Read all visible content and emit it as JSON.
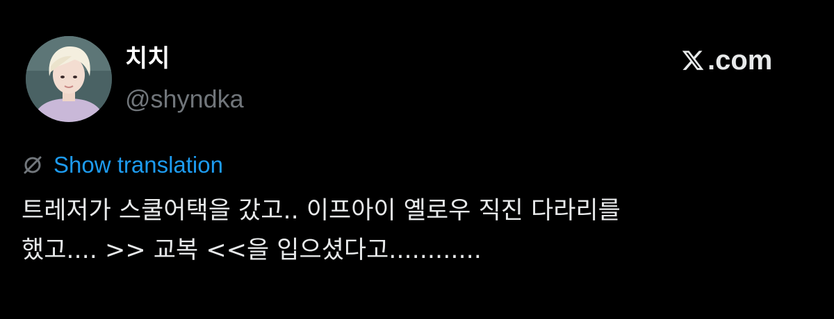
{
  "author": {
    "display_name": "치치",
    "handle": "@shyndka",
    "avatar_icon": "avatar-photo"
  },
  "brand": {
    "logo_icon": "x-logo-icon",
    "site_label": ".com"
  },
  "translation": {
    "icon": "globe-icon",
    "link_label": "Show translation",
    "color": "#1d9bf0"
  },
  "tweet": {
    "text": "트레저가 스쿨어택을 갔고.. 이프아이 옐로우 직진 다라리를\n했고.... >> 교복 <<을 입으셨다고............"
  },
  "colors": {
    "background": "#000000",
    "primary_text": "#e7e9ea",
    "secondary_text": "#71767b"
  }
}
